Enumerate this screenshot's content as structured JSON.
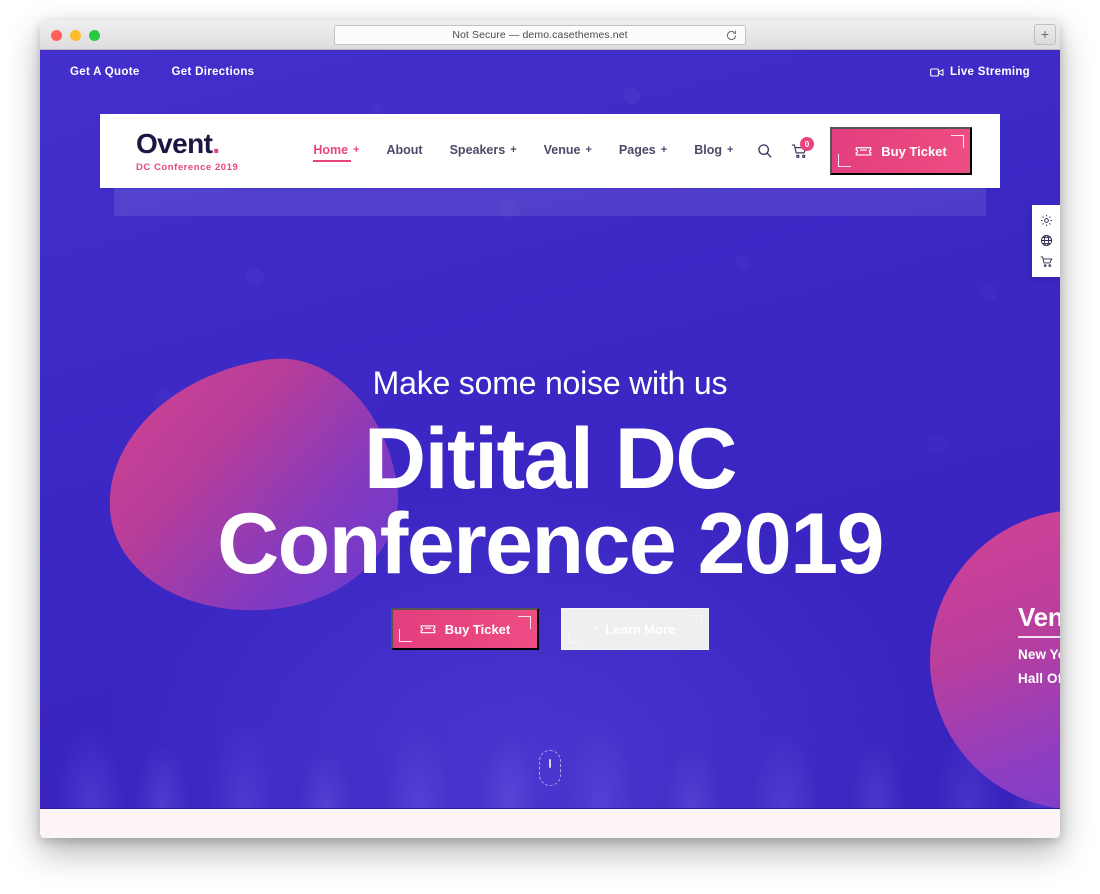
{
  "browser": {
    "url_text": "Not Secure — demo.casethemes.net",
    "reload_label": "reload",
    "new_tab_label": "+"
  },
  "topbar": {
    "links": [
      {
        "label": "Get A Quote"
      },
      {
        "label": "Get Directions"
      }
    ],
    "live_streaming_label": "Live Streming"
  },
  "header": {
    "logo_name": "Ovent",
    "logo_dot": ".",
    "logo_tagline": "DC Conference 2019",
    "nav": [
      {
        "label": "Home",
        "plus": "+",
        "active": true
      },
      {
        "label": "About",
        "plus": "",
        "active": false
      },
      {
        "label": "Speakers",
        "plus": "+",
        "active": false
      },
      {
        "label": "Venue",
        "plus": "+",
        "active": false
      },
      {
        "label": "Pages",
        "plus": "+",
        "active": false
      },
      {
        "label": "Blog",
        "plus": "+",
        "active": false
      }
    ],
    "cart_count": "0",
    "buy_ticket_label": "Buy Ticket"
  },
  "side_panel": {
    "items": [
      {
        "icon": "gear-icon"
      },
      {
        "icon": "globe-icon"
      },
      {
        "icon": "cart-icon"
      }
    ]
  },
  "hero": {
    "subtitle": "Make some noise with us",
    "title_line1": "Ditital DC",
    "title_line2": "Conference 2019",
    "buy_ticket_label": "Buy Ticket",
    "learn_more_label": "Learn More",
    "learn_more_chevron": "›"
  },
  "venue": {
    "heading": "Venue",
    "line1": "New York, US",
    "line2": "Hall Of Fame,"
  },
  "colors": {
    "background_indigo": "#3b27c4",
    "accent_pink": "#e8457f",
    "logo_navy": "#1b1642",
    "bottom_section": "#fdf4f6",
    "nav_text": "#4b4a6a"
  }
}
